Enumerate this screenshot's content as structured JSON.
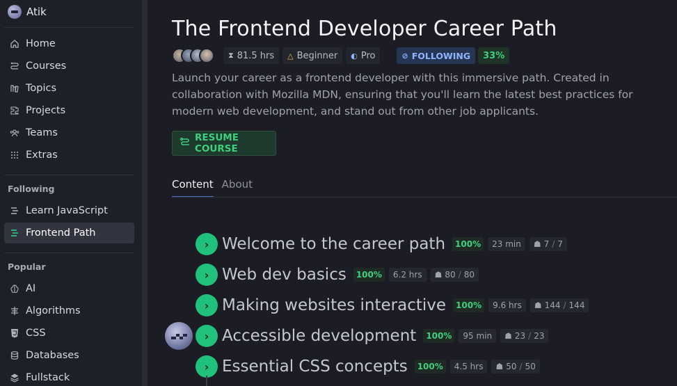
{
  "user": {
    "name": "Atik"
  },
  "nav": [
    {
      "label": "Home",
      "icon": "home-icon"
    },
    {
      "label": "Courses",
      "icon": "courses-icon"
    },
    {
      "label": "Topics",
      "icon": "topics-icon"
    },
    {
      "label": "Projects",
      "icon": "projects-icon"
    },
    {
      "label": "Teams",
      "icon": "teams-icon"
    },
    {
      "label": "Extras",
      "icon": "extras-icon"
    }
  ],
  "following": {
    "heading": "Following",
    "items": [
      {
        "label": "Learn JavaScript",
        "icon": "path-icon"
      },
      {
        "label": "Frontend Path",
        "icon": "path-icon"
      }
    ]
  },
  "popular": {
    "heading": "Popular",
    "items": [
      {
        "label": "AI",
        "icon": "ai-icon"
      },
      {
        "label": "Algorithms",
        "icon": "algorithms-icon"
      },
      {
        "label": "CSS",
        "icon": "css-icon"
      },
      {
        "label": "Databases",
        "icon": "database-icon"
      },
      {
        "label": "Fullstack",
        "icon": "fullstack-icon"
      }
    ]
  },
  "course": {
    "title": "The Frontend Developer Career Path",
    "duration": "81.5 hrs",
    "level": "Beginner",
    "tier": "Pro",
    "following_label": "FOLLOWING",
    "progress": "33%",
    "description": "Launch your career as a frontend developer with this immersive path. Created in collaboration with Mozilla MDN, ensuring that you'll learn the latest best practices for modern web development, and stand out from other job applicants.",
    "resume_label": "RESUME COURSE"
  },
  "tabs": [
    {
      "label": "Content",
      "active": true
    },
    {
      "label": "About",
      "active": false
    }
  ],
  "modules": [
    {
      "name": "Welcome to the career path",
      "pct": "100%",
      "duration": "23 min",
      "done": "7",
      "total": "7"
    },
    {
      "name": "Web dev basics",
      "pct": "100%",
      "duration": "6.2 hrs",
      "done": "80",
      "total": "80"
    },
    {
      "name": "Making websites interactive",
      "pct": "100%",
      "duration": "9.6 hrs",
      "done": "144",
      "total": "144"
    },
    {
      "name": "Accessible development",
      "pct": "100%",
      "duration": "95 min",
      "done": "23",
      "total": "23"
    },
    {
      "name": "Essential CSS concepts",
      "pct": "100%",
      "duration": "4.5 hrs",
      "done": "50",
      "total": "50"
    }
  ],
  "colors": {
    "accent_green": "#3ed07f",
    "check_green": "#1fc17b",
    "following_blue": "#8fb4ff",
    "background": "#1c1d24"
  }
}
